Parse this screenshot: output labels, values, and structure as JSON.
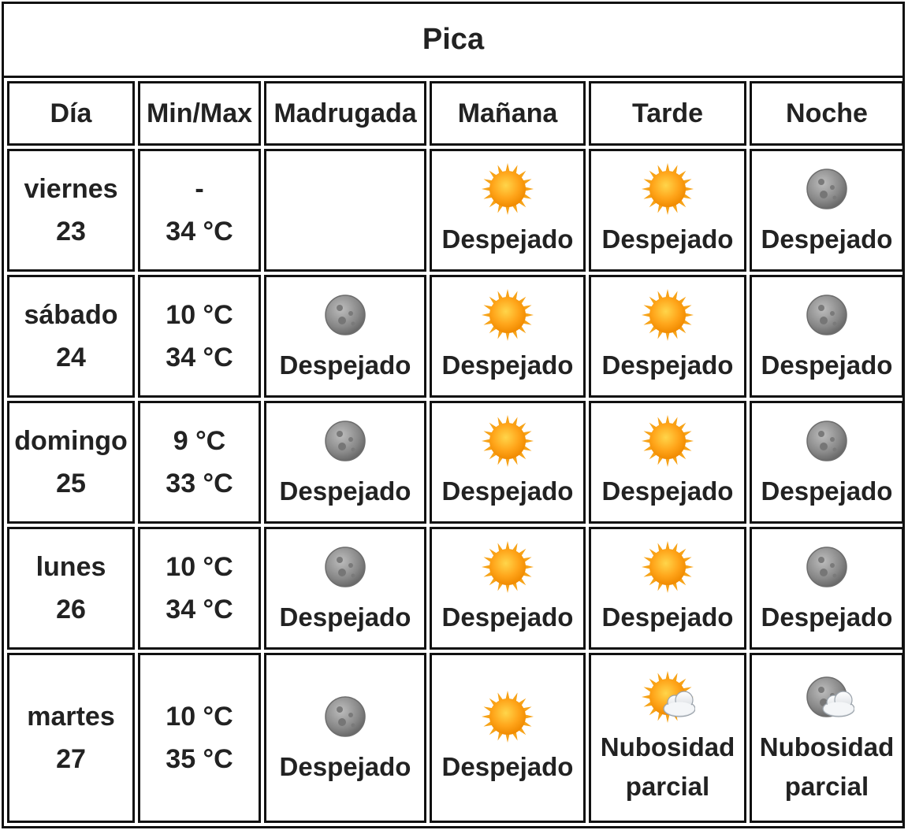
{
  "title": "Pica",
  "headers": [
    "Día",
    "Min/Max",
    "Madrugada",
    "Mañana",
    "Tarde",
    "Noche"
  ],
  "rows": [
    {
      "day": "viernes",
      "date": "23",
      "min": "-",
      "max": "34 °C",
      "periods": [
        {
          "icon": "",
          "label": ""
        },
        {
          "icon": "sun-icon",
          "label": "Despejado"
        },
        {
          "icon": "sun-icon",
          "label": "Despejado"
        },
        {
          "icon": "moon-icon",
          "label": "Despejado"
        }
      ]
    },
    {
      "day": "sábado",
      "date": "24",
      "min": "10 °C",
      "max": "34 °C",
      "periods": [
        {
          "icon": "moon-icon",
          "label": "Despejado"
        },
        {
          "icon": "sun-icon",
          "label": "Despejado"
        },
        {
          "icon": "sun-icon",
          "label": "Despejado"
        },
        {
          "icon": "moon-icon",
          "label": "Despejado"
        }
      ]
    },
    {
      "day": "domingo",
      "date": "25",
      "min": "9 °C",
      "max": "33 °C",
      "periods": [
        {
          "icon": "moon-icon",
          "label": "Despejado"
        },
        {
          "icon": "sun-icon",
          "label": "Despejado"
        },
        {
          "icon": "sun-icon",
          "label": "Despejado"
        },
        {
          "icon": "moon-icon",
          "label": "Despejado"
        }
      ]
    },
    {
      "day": "lunes",
      "date": "26",
      "min": "10 °C",
      "max": "34 °C",
      "periods": [
        {
          "icon": "moon-icon",
          "label": "Despejado"
        },
        {
          "icon": "sun-icon",
          "label": "Despejado"
        },
        {
          "icon": "sun-icon",
          "label": "Despejado"
        },
        {
          "icon": "moon-icon",
          "label": "Despejado"
        }
      ]
    },
    {
      "day": "martes",
      "date": "27",
      "min": "10 °C",
      "max": "35 °C",
      "periods": [
        {
          "icon": "moon-icon",
          "label": "Despejado"
        },
        {
          "icon": "sun-icon",
          "label": "Despejado"
        },
        {
          "icon": "sun-cloud-icon",
          "label": "Nubosidad parcial"
        },
        {
          "icon": "moon-cloud-icon",
          "label": "Nubosidad parcial"
        }
      ]
    }
  ]
}
